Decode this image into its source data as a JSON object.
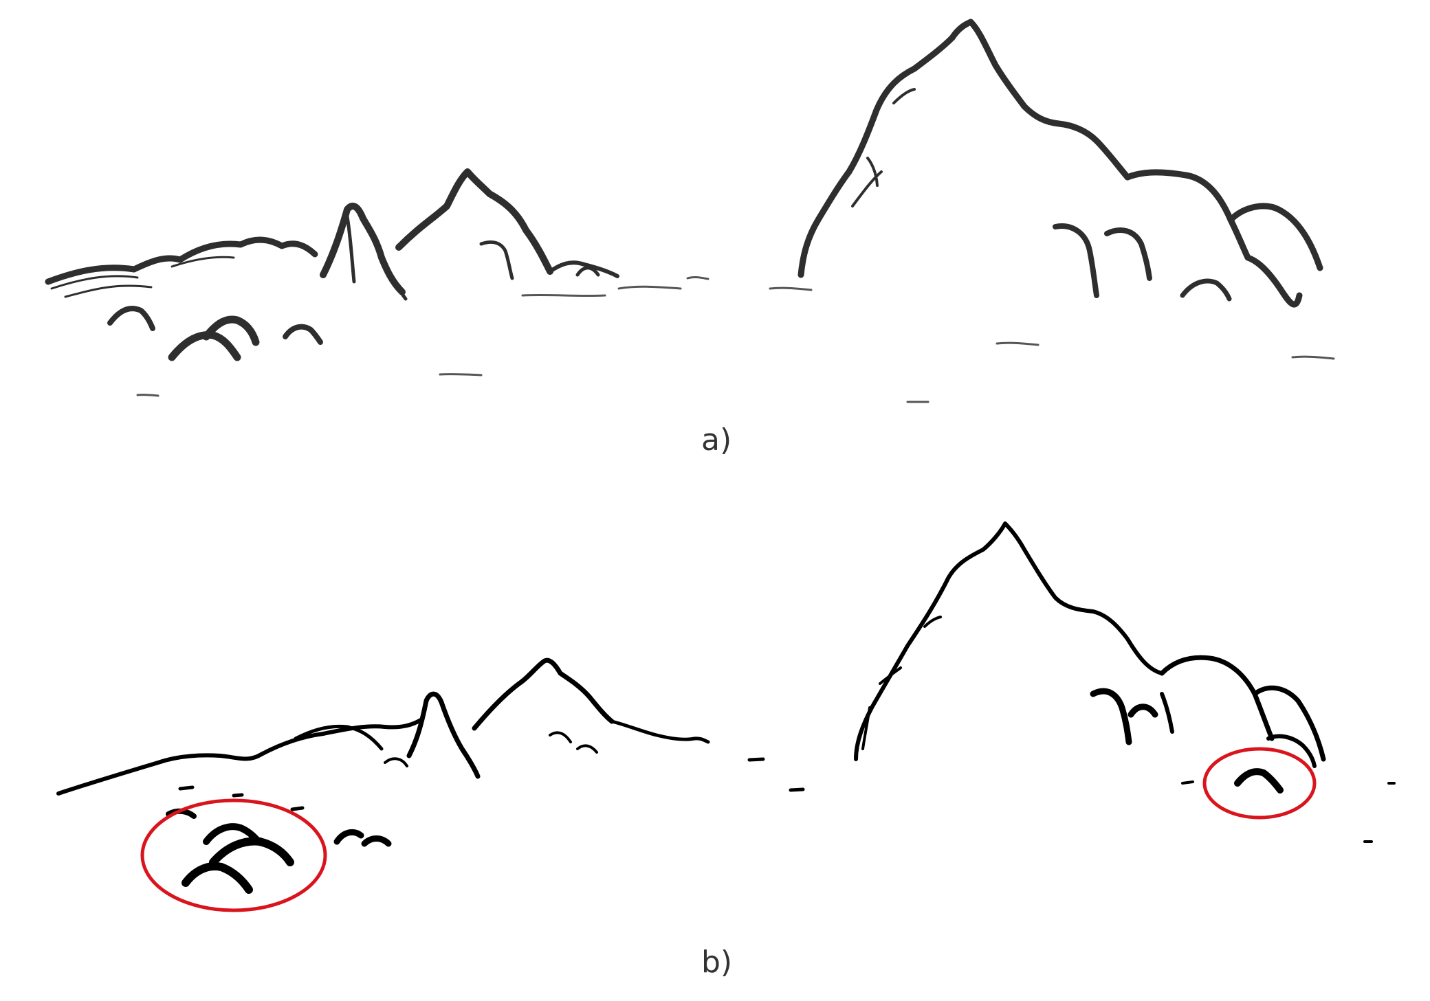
{
  "panels": [
    {
      "caption": "a)",
      "style": "sketch"
    },
    {
      "caption": "b)",
      "style": "ink"
    }
  ],
  "colors": {
    "sketch_stroke": "#2e2e2e",
    "ink_stroke": "#000000",
    "highlight": "#d9141c",
    "background": "#ffffff"
  }
}
